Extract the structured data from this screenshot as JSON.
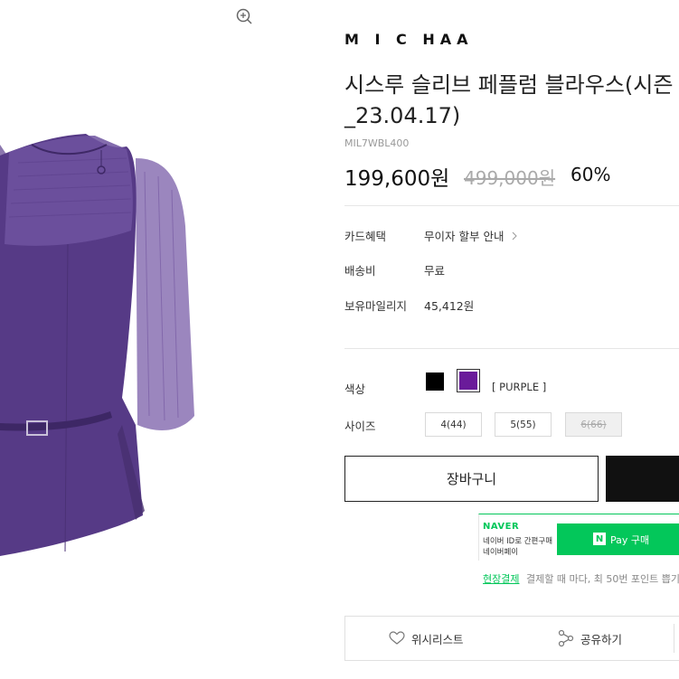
{
  "product": {
    "brand": "M I C HAA",
    "title_line1": "시스루 슬리브 페플럼 블라우스(시즌",
    "title_line2": "_23.04.17)",
    "model_code": "MIL7WBL400",
    "sale_price": "199,600원",
    "original_price": "499,000원",
    "discount": "60%",
    "garment_color": "#5b3d8c"
  },
  "info": {
    "card_label": "카드혜택",
    "card_value": "무이자 할부 안내",
    "shipping_label": "배송비",
    "shipping_value": "무료",
    "mileage_label": "보유마일리지",
    "mileage_value": "45,412원"
  },
  "options": {
    "color_label": "색상",
    "swatches": [
      {
        "name": "black",
        "color": "#000000"
      },
      {
        "name": "purple",
        "color": "#6a1b9a"
      }
    ],
    "selected_color": "[ PURPLE ]",
    "size_label": "사이즈",
    "sizes": [
      {
        "label": "4(44)",
        "available": true
      },
      {
        "label": "5(55)",
        "available": true
      },
      {
        "label": "6(66)",
        "available": false
      }
    ]
  },
  "buttons": {
    "cart": "장바구니"
  },
  "naver": {
    "logo": "NAVER",
    "desc1": "네이버 ID로 간편구매",
    "desc2": "네이버페이",
    "npay_badge": "N",
    "npay_label": "Pay 구매",
    "point_link": "현장결제",
    "point_text": "결제할 때 마다, 최 50번 포인트 쁩기",
    "brand_color": "#03c75a"
  },
  "actions": {
    "wishlist": "위시리스트",
    "share": "공유하기"
  },
  "icons": [
    "zoom-in-icon",
    "chevron-right-icon",
    "heart-icon",
    "share-icon"
  ]
}
